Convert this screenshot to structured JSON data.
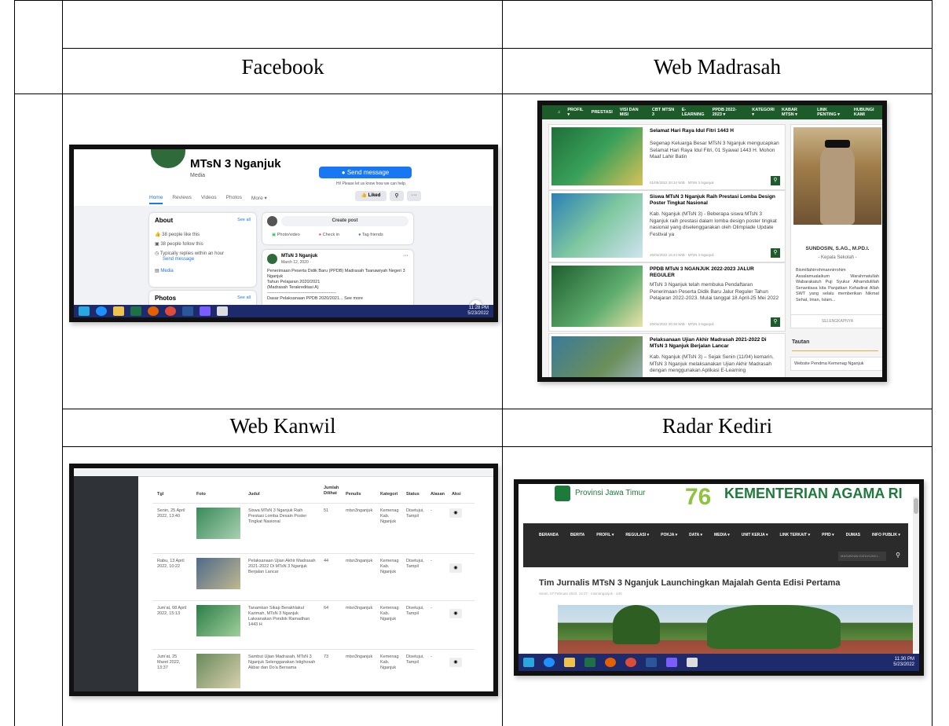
{
  "headers": {
    "facebook": "Facebook",
    "web_madrasah": "Web Madrasah",
    "web_kanwil": "Web Kanwil",
    "radar_kediri": "Radar Kediri"
  },
  "facebook": {
    "page_name": "MTsN 3 Nganjuk",
    "category": "Media",
    "send_message": "Send message",
    "send_note": "Hi! Please let us know how we can help.",
    "tabs": [
      "Home",
      "Reviews",
      "Videos",
      "Photos",
      "More ▾"
    ],
    "liked_label": "Liked",
    "about_title": "About",
    "see_all": "See all",
    "about_items": [
      "38 people like this",
      "38 people follow this",
      "Typically replies within an hour",
      "Send message",
      "Media"
    ],
    "photos_title": "Photos",
    "create_post": "Create post",
    "post_actions": [
      "Photo/video",
      "Check in",
      "Tag friends"
    ],
    "post_author": "MTsN 3 Nganjuk",
    "post_date": "March 12, 2020 · ",
    "post_lines": [
      "Penerimaan Peserta Didik Baru (PPDB) Madrasah Tsanawiyah Negeri 3",
      "Nganjuk",
      "Tahun Pelajaran 2020/2021",
      "(Madrasah Terakreditasi A)",
      "------------------------------------------------",
      "Dasar Pelaksanaan PPDB 2020/2021... See more"
    ],
    "clock_time": "11:28 PM",
    "clock_date": "5/23/2022"
  },
  "madrasah": {
    "nav": [
      "PROFIL ▾",
      "PRESTASI",
      "VISI DAN MISI",
      "CBT MTSN 3",
      "E-LEARNING",
      "PPDB 2022-2023 ▾",
      "KATEGORI ▾",
      "KABAR MTSN ▾",
      "LINK PENTING ▾",
      "HUBUNGI KAMI"
    ],
    "posts": [
      {
        "title": "Selamat Hari Raya Idul Fitri 1443 H",
        "excerpt": "Segenap Keluarga Besar MTsN 3 Nganjuk mengucapkan Selamat Hari Raya Idul Fitri, 01 Syawal 1443 H. Mohon Maaf Lahir Batin",
        "date": "01/05/2022 20:34 WIB · MTsN 3 Nganjuk"
      },
      {
        "title": "Siswa MTsN 3 Nganjuk Raih Prestasi Lomba Design Poster Tingkat Nasional",
        "excerpt": "Kab. Nganjuk (MTsN 3) - Beberapa siswa MTsN 3 Nganjuk raih prestasi dalam lomba design poster tingkat nasional yang diselenggarakan oleh Olimpiade Update Festival ya",
        "date": "26/04/2022 15:44 WIB · MTsN 3 Nganjuk"
      },
      {
        "title": "PPDB MTsN 3 NGANJUK 2022-2023 JALUR REGULER",
        "excerpt": "MTsN 3 Nganjuk telah membuka Pendaftaran Penerimaan Peserta Didik Baru Jalur Reguler Tahun Pelajaran 2022-2023. Mulai tanggal 18 April-25 Mei 2022",
        "date": "20/04/2022 20:39 WIB · MTsN 3 Nganjuk"
      },
      {
        "title": "Pelaksanaan Ujian Akhir Madrasah 2021-2022 Di MTsN 3 Nganjuk Berjalan Lancar",
        "excerpt": "Kab. Nganjuk (MTsN 3) – Sejak Senin (11/04) kemarin, MTsN 3 Nganjuk melaksanakan Ujian Akhir Madrasah dengan menggunakan Aplikasi E-Learning",
        "date": ""
      }
    ],
    "head_name": "SUNDOSIN, S.AG., M.PD.I.",
    "head_role": "- Kepala Sekolah -",
    "head_text": "Bismillahirrohmannirrohim Assalamualaikum Warahmatullah Wabarakatuh Puji Syukur Alhamdulillah Senantiasa kita Panjatkan Kehadirat Allah SWT yang selalu memberikan Nikmat Sehat, Iman, Islam...",
    "more": "SELENGKAPNYA",
    "tautan": "Tautan",
    "link1": "Website Pendma Kemenag Nganjuk"
  },
  "kanwil": {
    "columns": [
      "Tgl",
      "Foto",
      "Judul",
      "Jumlah Dilihat",
      "Penulis",
      "Kategori",
      "Status",
      "Alasan",
      "Aksi"
    ],
    "rows": [
      {
        "tgl": "Senin, 25 April 2022, 13:40",
        "judul": "Siswa MTsN 3 Nganjuk Raih Prestasi Lomba Desain Poster Tingkat Nasional",
        "dilihat": "51",
        "penulis": "mtsn3nganjuk",
        "kategori": "Kemenag Kab. Nganjuk",
        "status": "Disetujui, Tampil",
        "alasan": "-"
      },
      {
        "tgl": "Rabu, 13 April 2022, 10:22",
        "judul": "Pelaksanaan Ujian Akhir Madrasah 2021-2022 Di MTsN 3 Nganjuk Berjalan Lancar",
        "dilihat": "44",
        "penulis": "mtsn3nganjuk",
        "kategori": "Kemenag Kab. Nganjuk",
        "status": "Disetujui, Tampil",
        "alasan": "-"
      },
      {
        "tgl": "Jum'at, 08 April 2022, 15:13",
        "judul": "Tanamkan Sikap Berakhlakul Karimah, MTsN 3 Nganjuk Laksanakan Pondok Ramadhan 1443 H",
        "dilihat": "64",
        "penulis": "mtsn3nganjuk",
        "kategori": "Kemenag Kab. Nganjuk",
        "status": "Disetujui, Tampil",
        "alasan": "-"
      },
      {
        "tgl": "Jum'at, 25 Maret 2022, 13:37",
        "judul": "Sambut Ujian Madrasah, MTsN 3 Nganjuk Selenggarakan Istighosah Akbar dan Do'a Bersama",
        "dilihat": "73",
        "penulis": "mtsn3nganjuk",
        "kategori": "Kemenag Kab. Nganjuk",
        "status": "Disetujui, Tampil",
        "alasan": "-"
      }
    ]
  },
  "kemenag": {
    "province": "Provinsi Jawa Timur",
    "brand": "KEMENTERIAN AGAMA RI",
    "nav": [
      "BERANDA",
      "BERITA",
      "PROFIL ▾",
      "REGULASI ▾",
      "POKJA ▾",
      "DATA ▾",
      "MEDIA ▾",
      "UNIT KERJA ▾",
      "LINK TERKAIT ▾",
      "PPID ▾",
      "DUMAS",
      "INFO PUBLIK ▾"
    ],
    "search_placeholder": "MASUKKAN KATA KUNCI...",
    "headline": "Tim Jurnalis MTsN 3 Nganjuk Launchingkan Majalah Genta Edisi Pertama",
    "meta": "Senin, 07 Februari 2022, 14:27  ·  mtsn3nganjuk  ·  430",
    "clock_time": "11:30 PM",
    "clock_date": "5/23/2022"
  }
}
